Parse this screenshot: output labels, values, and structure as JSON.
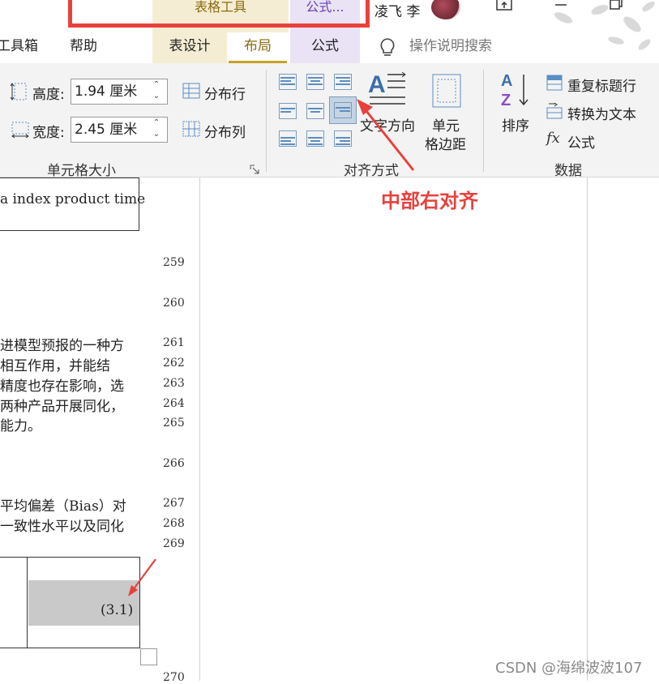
{
  "titlebar": {
    "context_table_tools": "表格工具",
    "context_formula": "公式...",
    "user_name": "凌飞 李"
  },
  "ribbon_tabs": {
    "toolbox": "工具箱",
    "help": "帮助",
    "table_design": "表设计",
    "layout": "布局",
    "formula": "公式",
    "tell_me": "操作说明搜索"
  },
  "cell_size": {
    "height_label": "高度:",
    "height_value": "1.94 厘米",
    "width_label": "宽度:",
    "width_value": "2.45 厘米",
    "distribute_rows": "分布行",
    "distribute_cols": "分布列",
    "group_label": "单元格大小"
  },
  "alignment": {
    "text_direction": "文字方向",
    "cell_margins_line1": "单元",
    "cell_margins_line2": "格边距",
    "group_label": "对齐方式",
    "selected": "middle-right",
    "callout": "中部右对齐"
  },
  "data_group": {
    "sort": "排序",
    "repeat_header": "重复标题行",
    "convert_to_text": "转换为文本",
    "formula": "公式",
    "group_label": "数据"
  },
  "document": {
    "top_cell_text": "a index product time",
    "paragraph1": [
      "进模型预报的一种方",
      "相互作用，并能结",
      "精度也存在影响，选",
      "两种产品开展同化，",
      "能力。"
    ],
    "paragraph2": [
      "平均偏差（Bias）对",
      "一致性水平以及同化"
    ],
    "equation_number": "(3.1)",
    "line_numbers": [
      "259",
      "260",
      "261",
      "262",
      "263",
      "264",
      "265",
      "266",
      "267",
      "268",
      "269",
      "270"
    ]
  },
  "watermark": "CSDN @海绵波波107",
  "colors": {
    "annotation_red": "#e8413c",
    "context_table_bg": "#f5edd3",
    "context_formula_bg": "#e9e3f5",
    "selected_cell_gray": "#c9c9c9"
  }
}
